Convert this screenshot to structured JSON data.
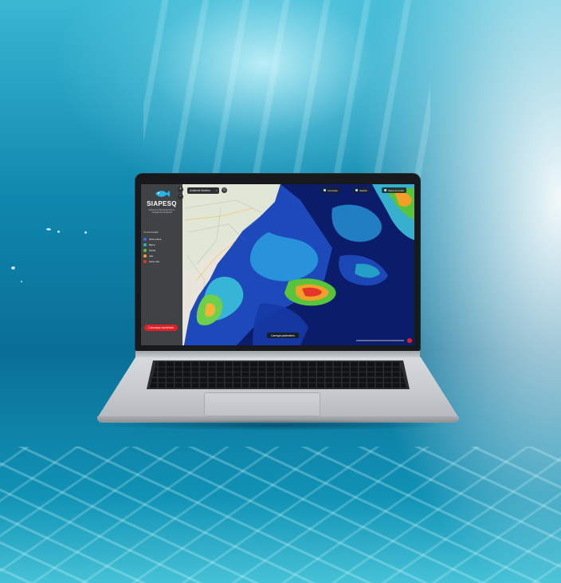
{
  "app": {
    "logo_text": "SIAPESQ",
    "logo_subtitle": "Sistema de Monitoramento e Inteligência Ambiental"
  },
  "legend": {
    "title": "Concentração",
    "items": [
      {
        "label": "Muito baixa",
        "color": "#3b6fd6"
      },
      {
        "label": "Baixa",
        "color": "#26b5c9"
      },
      {
        "label": "Média",
        "color": "#58c43c"
      },
      {
        "label": "Alta",
        "color": "#f2a02a"
      },
      {
        "label": "Muito alta",
        "color": "#e3362b"
      }
    ]
  },
  "search": {
    "value": "Ambiente Marinho"
  },
  "top_buttons": [
    {
      "label": "Camadas",
      "icon": "layers-icon"
    },
    {
      "label": "Satélite",
      "icon": "satellite-icon"
    },
    {
      "label": "Mapa de fundo",
      "icon": "map-icon"
    }
  ],
  "bottom_pill": {
    "label": "Carregar parâmetros"
  },
  "cta_button": {
    "label": "Comunicar ocorrência"
  },
  "colors": {
    "accent": "#e02026",
    "sidebar": "#2b2f33",
    "ocean_low": "#0b1e6e",
    "ocean_high": "#e3362b"
  }
}
